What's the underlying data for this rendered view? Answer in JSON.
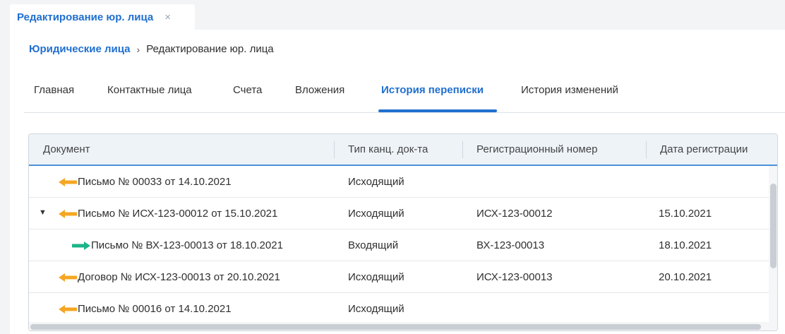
{
  "tab_strip": {
    "document_tab_label": "Редактирование юр. лица",
    "close_glyph": "×"
  },
  "breadcrumb": {
    "parent": "Юридические лица",
    "separator": "›",
    "current": "Редактирование юр. лица"
  },
  "tabs": [
    {
      "label": "Главная"
    },
    {
      "label": "Контактные лица"
    },
    {
      "label": "Счета"
    },
    {
      "label": "Вложения"
    },
    {
      "label": "История переписки",
      "active": true
    },
    {
      "label": "История изменений"
    }
  ],
  "grid": {
    "columns": [
      "Документ",
      "Тип канц. док-та",
      "Регистрационный номер",
      "Дата регистрации"
    ],
    "rows": [
      {
        "document": "Письмо № 00033 от 14.10.2021",
        "type": "Исходящий",
        "reg_number": "",
        "reg_date": "",
        "direction": "outgoing",
        "level": 0,
        "expander": ""
      },
      {
        "document": "Письмо № ИСХ-123-00012 от 15.10.2021",
        "type": "Исходящий",
        "reg_number": "ИСХ-123-00012",
        "reg_date": "15.10.2021",
        "direction": "outgoing",
        "level": 0,
        "expander": "▼"
      },
      {
        "document": "Письмо № ВХ-123-00013 от 18.10.2021",
        "type": "Входящий",
        "reg_number": "ВХ-123-00013",
        "reg_date": "18.10.2021",
        "direction": "incoming",
        "level": 1,
        "expander": ""
      },
      {
        "document": "Договор № ИСХ-123-00013 от 20.10.2021",
        "type": "Исходящий",
        "reg_number": "ИСХ-123-00013",
        "reg_date": "20.10.2021",
        "direction": "outgoing",
        "level": 0,
        "expander": ""
      },
      {
        "document": "Письмо № 00016 от 14.10.2021",
        "type": "Исходящий",
        "reg_number": "",
        "reg_date": "",
        "direction": "outgoing",
        "level": 0,
        "expander": ""
      }
    ]
  },
  "colors": {
    "accent": "#1f6fcf",
    "outgoing_arrow": "#f5a623",
    "incoming_arrow": "#1db48a"
  },
  "icons": {
    "outgoing": "arrow-left-icon",
    "incoming": "arrow-right-icon"
  }
}
